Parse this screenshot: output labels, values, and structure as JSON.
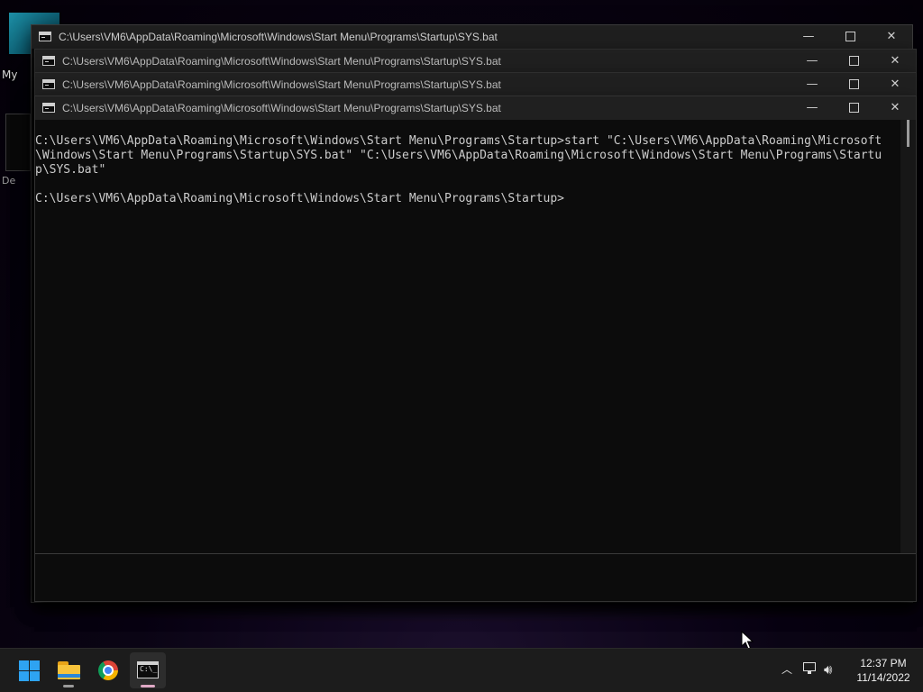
{
  "desktop": {
    "label_1": "My",
    "label_2": "De"
  },
  "windows": [
    {
      "title": "C:\\Users\\VM6\\AppData\\Roaming\\Microsoft\\Windows\\Start Menu\\Programs\\Startup\\SYS.bat",
      "controls": {
        "minimize": "—",
        "close": "✕"
      }
    },
    {
      "title": "C:\\Users\\VM6\\AppData\\Roaming\\Microsoft\\Windows\\Start Menu\\Programs\\Startup\\SYS.bat",
      "controls": {
        "minimize": "—",
        "close": "✕"
      }
    },
    {
      "title": "C:\\Users\\VM6\\AppData\\Roaming\\Microsoft\\Windows\\Start Menu\\Programs\\Startup\\SYS.bat",
      "controls": {
        "minimize": "—",
        "close": "✕"
      }
    },
    {
      "title": "C:\\Users\\VM6\\AppData\\Roaming\\Microsoft\\Windows\\Start Menu\\Programs\\Startup\\SYS.bat",
      "controls": {
        "minimize": "—",
        "close": "✕"
      }
    }
  ],
  "console": {
    "text": "C:\\Users\\VM6\\AppData\\Roaming\\Microsoft\\Windows\\Start Menu\\Programs\\Startup>start \"C:\\Users\\VM6\\AppData\\Roaming\\Microsoft\n\\Windows\\Start Menu\\Programs\\Startup\\SYS.bat\" \"C:\\Users\\VM6\\AppData\\Roaming\\Microsoft\\Windows\\Start Menu\\Programs\\Startu\np\\SYS.bat\"\n\nC:\\Users\\VM6\\AppData\\Roaming\\Microsoft\\Windows\\Start Menu\\Programs\\Startup>"
  },
  "taskbar": {
    "apps": [
      {
        "name": "Start",
        "icon": "windows-logo-icon"
      },
      {
        "name": "File Explorer",
        "icon": "folder-icon"
      },
      {
        "name": "Google Chrome",
        "icon": "chrome-icon"
      },
      {
        "name": "Command Prompt",
        "icon": "cmd-icon",
        "icon_text": "C:\\_"
      }
    ],
    "tray": {
      "overflow_icon": "chevron-up-icon",
      "network_icon": "network-icon",
      "volume_icon": "volume-icon",
      "overflow_glyph": "︿",
      "volume_glyph": "🔊︎"
    },
    "clock": {
      "time": "12:37 PM",
      "date": "11/14/2022"
    }
  }
}
